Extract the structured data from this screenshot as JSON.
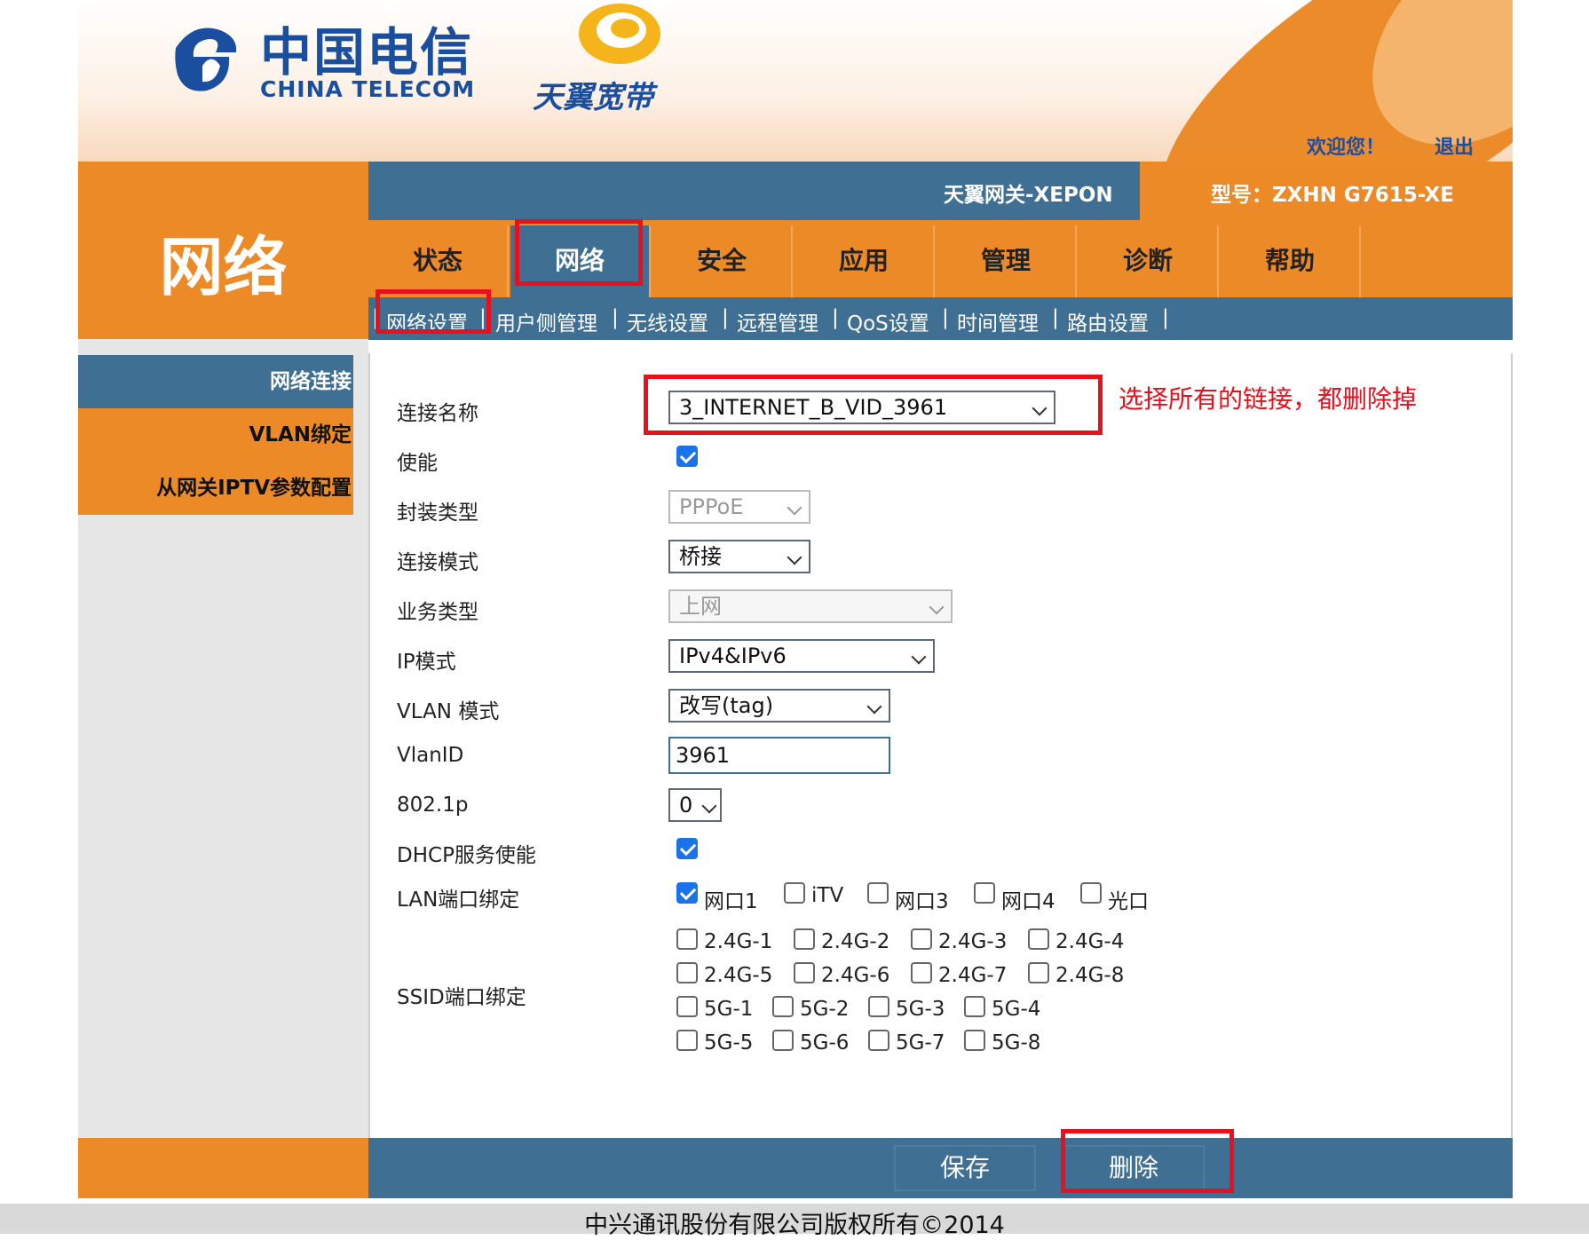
{
  "header": {
    "brand_cn": "中国电信",
    "brand_en": "CHINA TELECOM",
    "product": "天翼宽带",
    "welcome": "欢迎您！",
    "logout": "退出"
  },
  "page_title": "网络",
  "banner": {
    "gateway": "天翼网关-XEPON",
    "model": "型号：ZXHN G7615-XE"
  },
  "tabs": [
    {
      "label": "状态"
    },
    {
      "label": "网络"
    },
    {
      "label": "安全"
    },
    {
      "label": "应用"
    },
    {
      "label": "管理"
    },
    {
      "label": "诊断"
    },
    {
      "label": "帮助"
    }
  ],
  "subnav": [
    "网络设置",
    "用户侧管理",
    "无线设置",
    "远程管理",
    "QoS设置",
    "时间管理",
    "路由设置"
  ],
  "sidebar": [
    "网络连接",
    "VLAN绑定",
    "从网关IPTV参数配置"
  ],
  "form": {
    "conn_name_label": "连接名称",
    "conn_name_value": "3_INTERNET_B_VID_3961",
    "enable_label": "使能",
    "encap_label": "封装类型",
    "encap_value": "PPPoE",
    "mode_label": "连接模式",
    "mode_value": "桥接",
    "service_label": "业务类型",
    "service_value": "上网",
    "ip_label": "IP模式",
    "ip_value": "IPv4&IPv6",
    "vlan_mode_label": "VLAN 模式",
    "vlan_mode_value": "改写(tag)",
    "vlanid_label": "VlanID",
    "vlanid_value": "3961",
    "p8021_label": "802.1p",
    "p8021_value": "0",
    "dhcp_label": "DHCP服务使能",
    "lan_label": "LAN端口绑定",
    "lan_ports": [
      "网口1",
      "iTV",
      "网口3",
      "网口4",
      "光口"
    ],
    "ssid_label": "SSID端口绑定",
    "ssid_rows": [
      [
        "2.4G-1",
        "2.4G-2",
        "2.4G-3",
        "2.4G-4"
      ],
      [
        "2.4G-5",
        "2.4G-6",
        "2.4G-7",
        "2.4G-8"
      ],
      [
        "5G-1",
        "5G-2",
        "5G-3",
        "5G-4"
      ],
      [
        "5G-5",
        "5G-6",
        "5G-7",
        "5G-8"
      ]
    ]
  },
  "annotation": "选择所有的链接，都删除掉",
  "buttons": {
    "save": "保存",
    "delete": "删除"
  },
  "footer": "中兴通讯股份有限公司版权所有©2014"
}
